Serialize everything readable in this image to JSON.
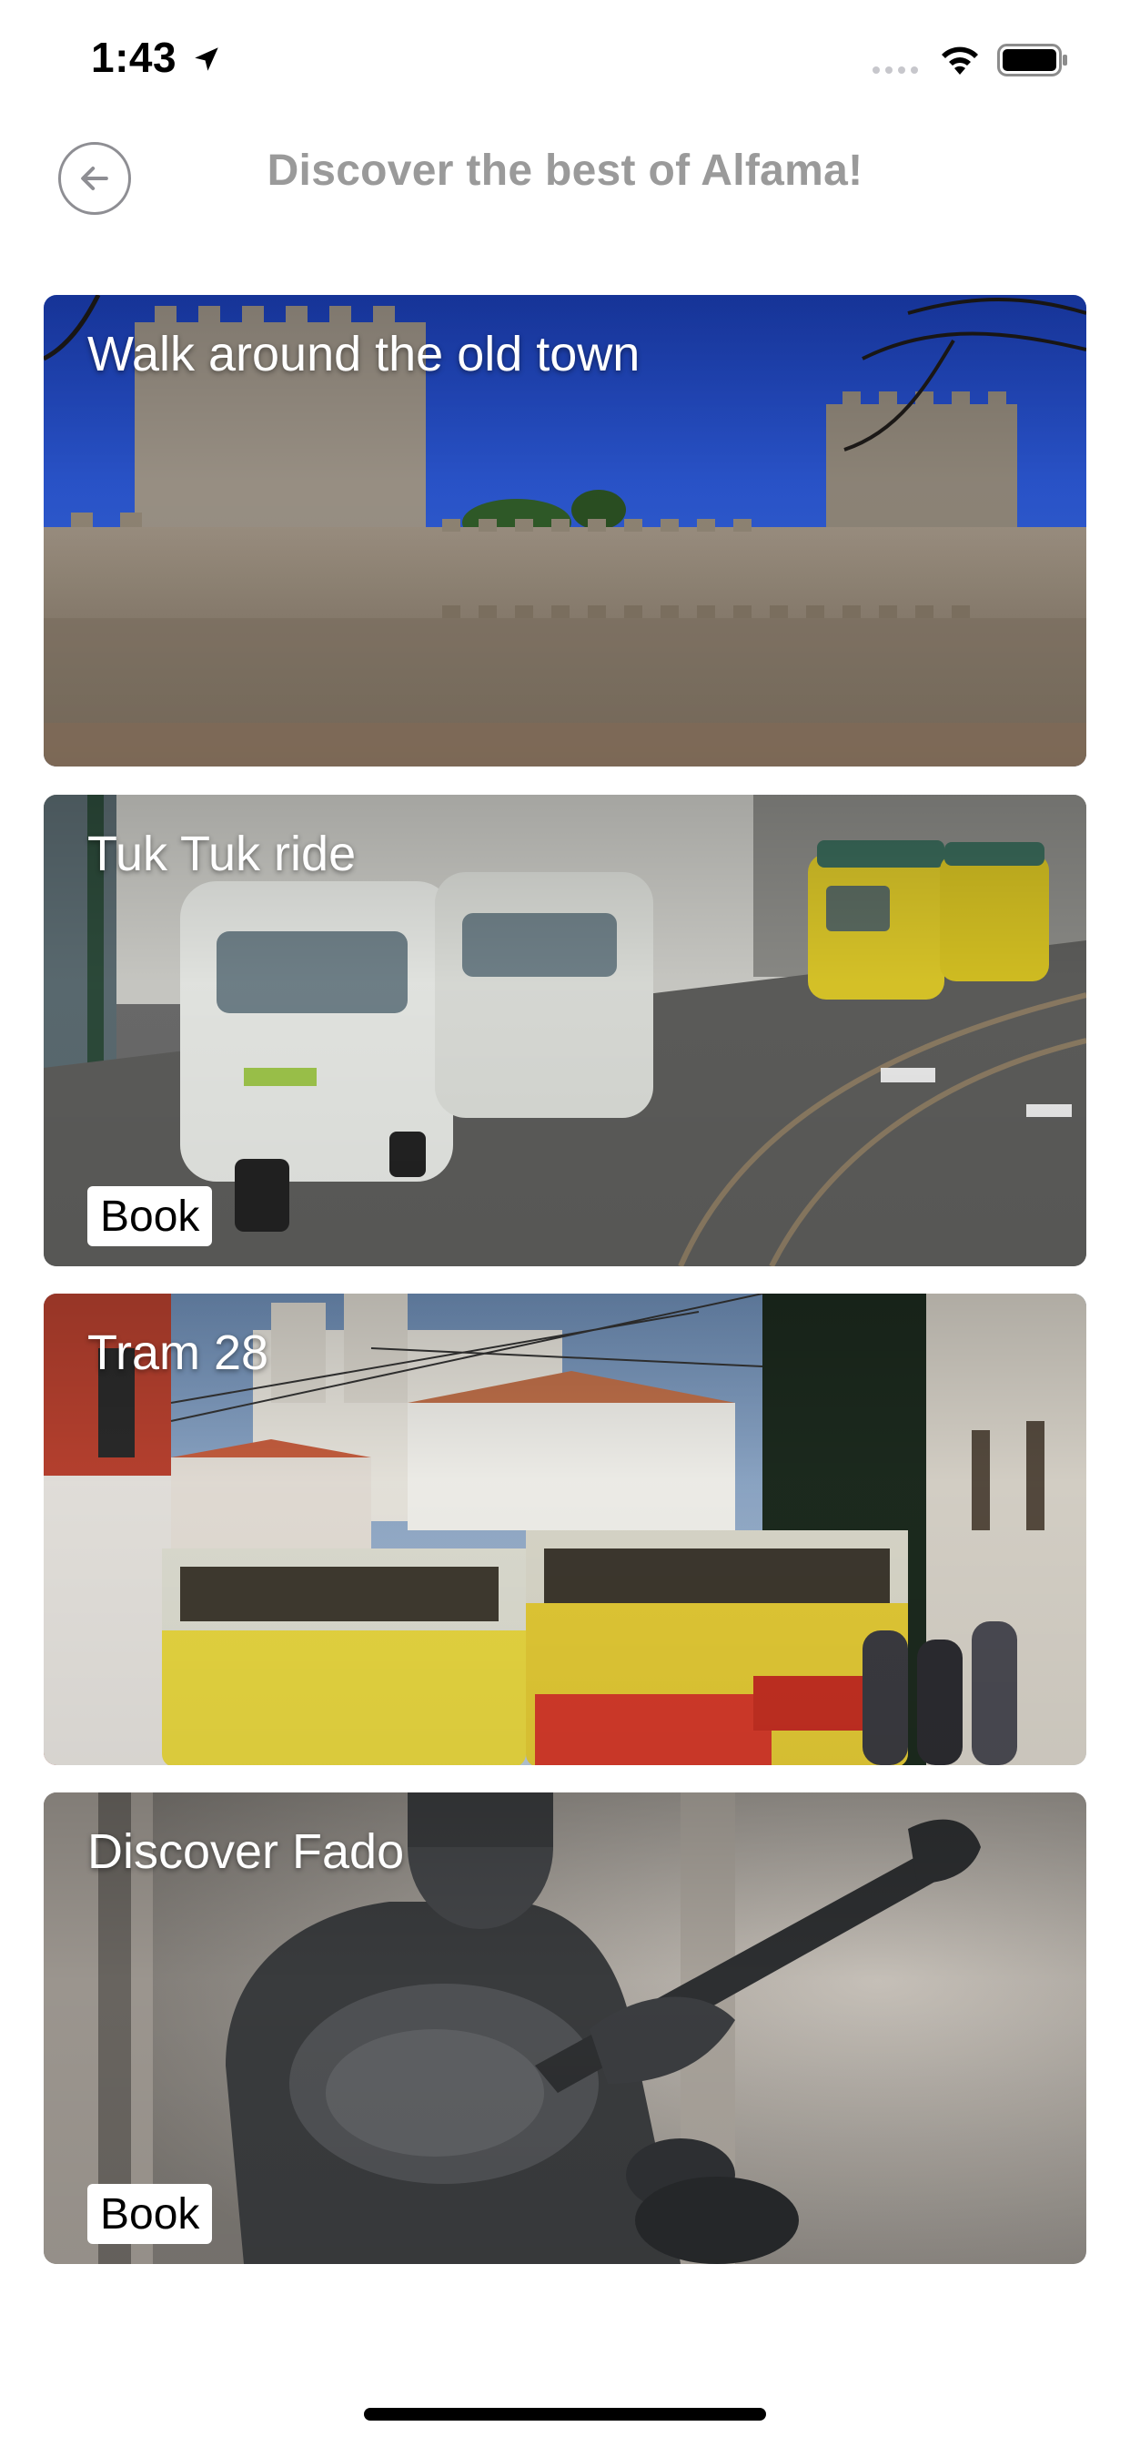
{
  "status_bar": {
    "time": "1:43",
    "icons": [
      "location-arrow-icon",
      "cellular-dots-icon",
      "wifi-icon",
      "battery-icon"
    ]
  },
  "header": {
    "title": "Discover the best of Alfama!",
    "back_icon": "back-arrow-icon"
  },
  "cards": [
    {
      "title": "Walk around the old town",
      "has_book": false
    },
    {
      "title": "Tuk Tuk ride",
      "has_book": true,
      "book_label": "Book"
    },
    {
      "title": "Tram 28",
      "has_book": false
    },
    {
      "title": "Discover Fado",
      "has_book": true,
      "book_label": "Book"
    }
  ],
  "colors": {
    "title_text": "#9a9a9a",
    "back_circle": "#8e8e93",
    "card_title": "#ffffff",
    "book_bg": "#ffffff"
  }
}
